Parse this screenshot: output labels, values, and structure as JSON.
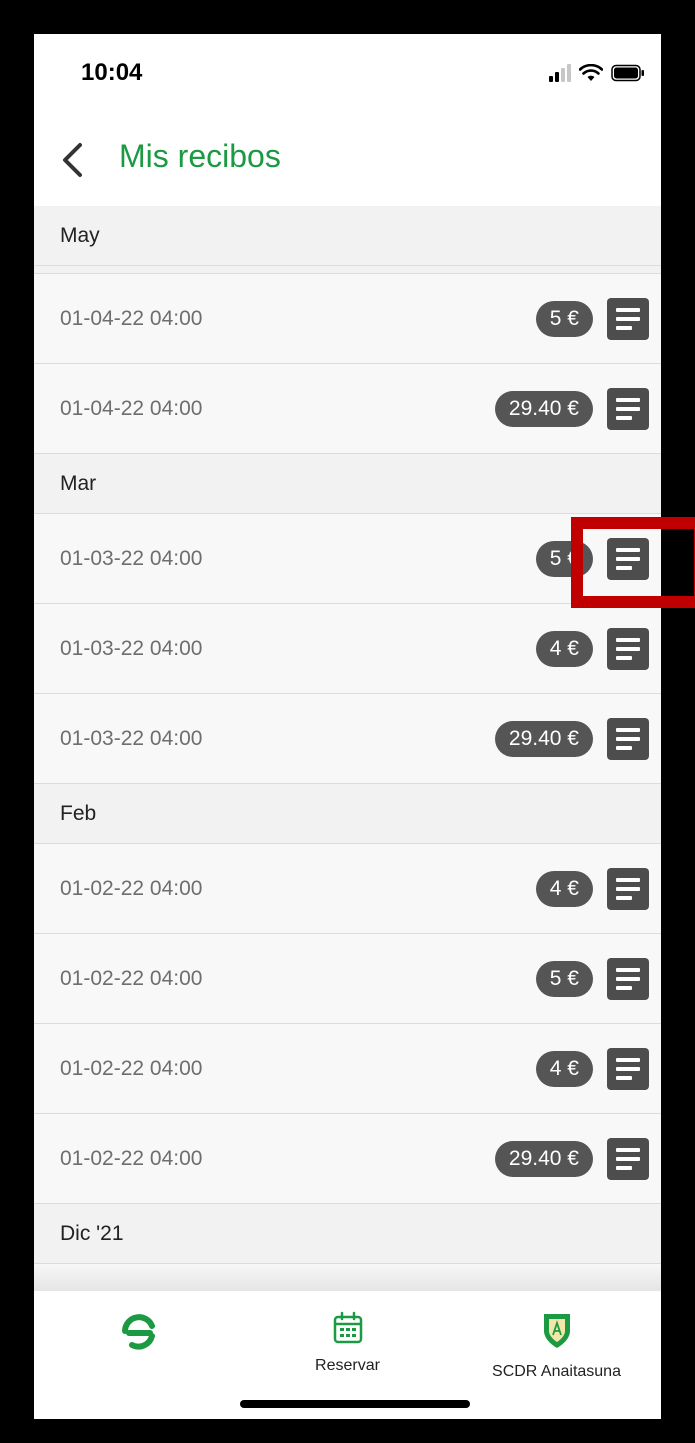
{
  "status_bar": {
    "time": "10:04"
  },
  "header": {
    "title": "Mis recibos"
  },
  "sections": [
    {
      "label": "May",
      "rows": [
        {
          "date": "01-04-22 04:00",
          "amount": "5 €"
        },
        {
          "date": "01-04-22 04:00",
          "amount": "29.40 €"
        }
      ]
    },
    {
      "label": "Mar",
      "rows": [
        {
          "date": "01-03-22 04:00",
          "amount": "5 €"
        },
        {
          "date": "01-03-22 04:00",
          "amount": "4 €"
        },
        {
          "date": "01-03-22 04:00",
          "amount": "29.40 €"
        }
      ]
    },
    {
      "label": "Feb",
      "rows": [
        {
          "date": "01-02-22 04:00",
          "amount": "4 €"
        },
        {
          "date": "01-02-22 04:00",
          "amount": "5 €"
        },
        {
          "date": "01-02-22 04:00",
          "amount": "4 €"
        },
        {
          "date": "01-02-22 04:00",
          "amount": "29.40 €"
        }
      ]
    },
    {
      "label": "Dic '21",
      "rows": []
    }
  ],
  "tab_bar": {
    "tabs": [
      {
        "icon": "app-logo-icon",
        "label": ""
      },
      {
        "icon": "calendar-icon",
        "label": "Reservar"
      },
      {
        "icon": "club-shield-icon",
        "label": "SCDR Anaitasuna"
      }
    ]
  },
  "colors": {
    "accent": "#1c9a43",
    "badge": "#555555",
    "highlight": "#c00000"
  }
}
